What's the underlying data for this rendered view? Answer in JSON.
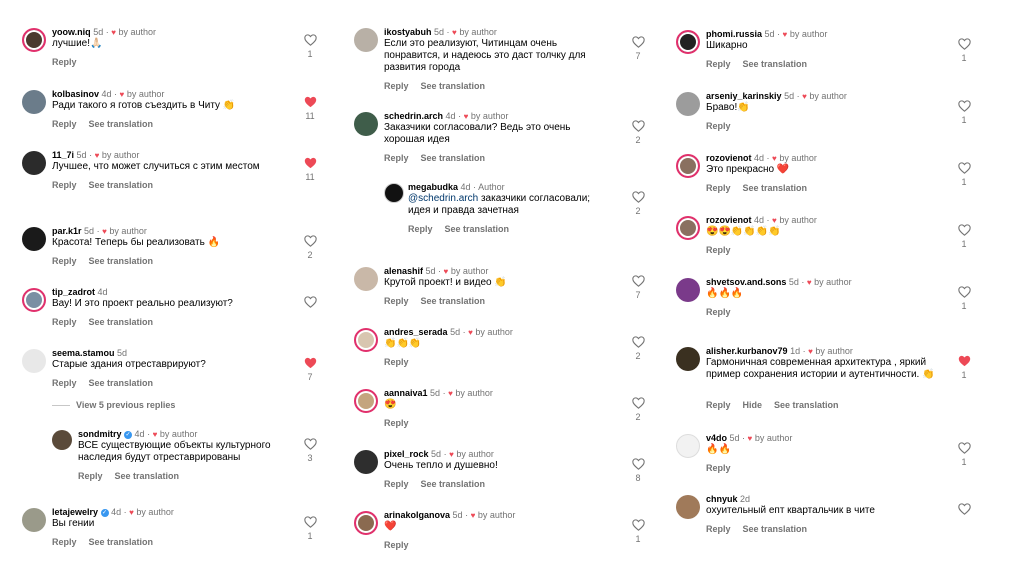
{
  "common": {
    "reply": "Reply",
    "see_translation": "See translation",
    "hide": "Hide",
    "by_author": "by author",
    "author_label": "Author"
  },
  "columns": [
    [
      {
        "user": "yoow.niq",
        "time": "5d",
        "text": "лучшие!🙏🏻",
        "likes": "1",
        "liked": false,
        "translate": false
      },
      {
        "user": "kolbasinov",
        "time": "4d",
        "text": "Ради такого я готов съездить в Читу 👏",
        "likes": "11",
        "liked": true,
        "translate": true
      },
      {
        "user": "11_7i",
        "time": "5d",
        "text": "Лучшее, что может случиться с этим местом",
        "likes": "11",
        "liked": true,
        "translate": true
      },
      {
        "user": "par.k1r",
        "time": "5d",
        "text": "Красота! Теперь бы реализовать 🔥",
        "likes": "2",
        "liked": false,
        "translate": true
      },
      {
        "user": "tip_zadrot",
        "time": "4d",
        "text": "Вау! И это проект реально реализуют?",
        "likes": "",
        "liked": false,
        "translate": true,
        "noauthor": true
      },
      {
        "user": "seema.stamou",
        "time": "5d",
        "text": "Старые здания отреставрируют?",
        "likes": "7",
        "liked": true,
        "translate": true,
        "noauthor": true
      },
      {
        "user": "sondmitry",
        "time": "4d",
        "text": "ВСЕ существующие объекты культурного наследия будут отреставрированы",
        "likes": "3",
        "liked": false,
        "translate": true,
        "verified": true,
        "reply": true
      },
      {
        "user": "letajewelry",
        "time": "4d",
        "text": "Вы гении",
        "likes": "1",
        "liked": false,
        "translate": true,
        "verified": true
      }
    ],
    [
      {
        "user": "ikostyabuh",
        "time": "5d",
        "text": "Если это реализуют, Читинцам очень понравится, и надеюсь это даст толчку для развития города",
        "likes": "7",
        "liked": false,
        "translate": true
      },
      {
        "user": "schedrin.arch",
        "time": "4d",
        "text": "Заказчики согласовали? Ведь это очень хорошая идея",
        "likes": "2",
        "liked": false,
        "translate": true
      },
      {
        "user": "megabudka",
        "time": "4d",
        "mention": "@schedrin.arch",
        "text": " заказчики согласовали; идея и правда зачетная",
        "likes": "2",
        "liked": false,
        "translate": true,
        "reply": true,
        "isauthor": true
      },
      {
        "user": "alenashif",
        "time": "5d",
        "text": "Крутой проект! и видео 👏",
        "likes": "7",
        "liked": false,
        "translate": true
      },
      {
        "user": "andres_serada",
        "time": "5d",
        "text": "👏👏👏",
        "likes": "2",
        "liked": false,
        "translate": false
      },
      {
        "user": "aannaiva1",
        "time": "5d",
        "text": "😍",
        "likes": "2",
        "liked": false,
        "translate": false
      },
      {
        "user": "pixel_rock",
        "time": "5d",
        "text": "Очень тепло и душевно!",
        "likes": "8",
        "liked": false,
        "translate": true
      },
      {
        "user": "arinakolganova",
        "time": "5d",
        "text": "❤️",
        "likes": "1",
        "liked": false,
        "translate": false
      }
    ],
    [
      {
        "user": "phomi.russia",
        "time": "5d",
        "text": "Шикарно",
        "likes": "1",
        "liked": false,
        "translate": true
      },
      {
        "user": "arseniy_karinskiy",
        "time": "5d",
        "text": "Браво!👏",
        "likes": "1",
        "liked": false,
        "translate": false
      },
      {
        "user": "rozovienot",
        "time": "4d",
        "text": "Это прекрасно ❤️",
        "likes": "1",
        "liked": false,
        "translate": true
      },
      {
        "user": "rozovienot",
        "time": "4d",
        "text": "😍😍👏👏👏👏",
        "likes": "1",
        "liked": false,
        "translate": false
      },
      {
        "user": "shvetsov.and.sons",
        "time": "5d",
        "text": "🔥🔥🔥",
        "likes": "1",
        "liked": false,
        "translate": false
      },
      {
        "user": "alisher.kurbanov79",
        "time": "1d",
        "text": "Гармоничная современная архитектура , яркий пример сохранения истории и аутентичности. 👏",
        "likes": "1",
        "liked": true,
        "translate": true,
        "hide": true
      },
      {
        "user": "v4do",
        "time": "5d",
        "text": "🔥🔥",
        "likes": "1",
        "liked": false,
        "translate": false
      },
      {
        "user": "chnyuk",
        "time": "2d",
        "text": "охуительный епт квартальчик в чите",
        "likes": "",
        "liked": false,
        "translate": true,
        "noauthor": true
      }
    ]
  ],
  "view_previous": "View 5 previous replies"
}
